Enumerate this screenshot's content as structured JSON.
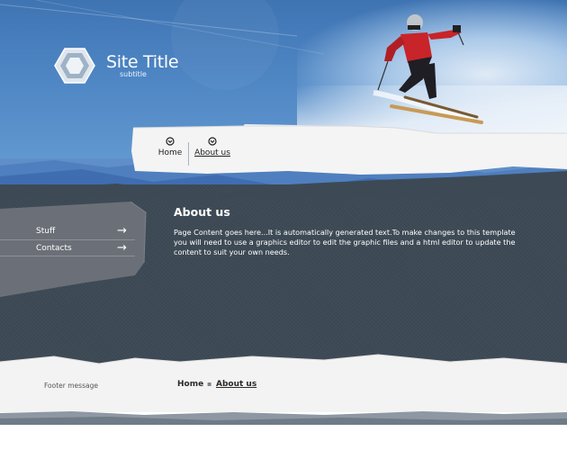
{
  "site": {
    "title": "Site Title",
    "subtitle": "subtitle"
  },
  "nav": {
    "items": [
      {
        "label": "Home"
      },
      {
        "label": "About us"
      }
    ]
  },
  "sidebar": {
    "items": [
      {
        "label": "Stuff",
        "icon": "arrow-right-icon"
      },
      {
        "label": "Contacts",
        "icon": "arrow-right-icon"
      }
    ]
  },
  "main": {
    "heading": "About us",
    "body": "Page Content goes here...It is automatically generated text.To make changes to this template you will need to use a graphics editor to edit the graphic files and a html editor to update the content to suit your own needs."
  },
  "footer": {
    "message": "Footer message",
    "breadcrumb": {
      "home": "Home",
      "separator": "▪",
      "current": "About us"
    }
  },
  "colors": {
    "header_blue": "#4e86c4",
    "content_dark": "#3d4a55",
    "sidebar_gray": "#6b7078",
    "paper": "#f2f2f2"
  }
}
